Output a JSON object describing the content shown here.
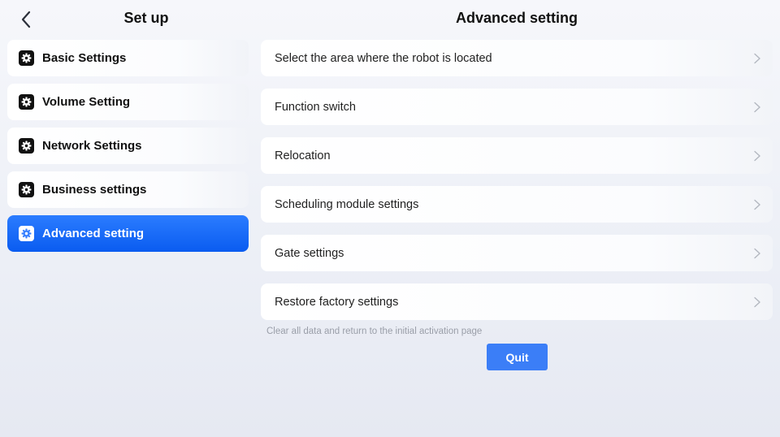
{
  "left_panel": {
    "title": "Set up",
    "back_icon": "chevron-left-icon",
    "items": [
      {
        "label": "Basic Settings",
        "icon": "gear-icon",
        "active": false
      },
      {
        "label": "Volume Setting",
        "icon": "gear-icon",
        "active": false
      },
      {
        "label": "Network Settings",
        "icon": "gear-icon",
        "active": false
      },
      {
        "label": "Business settings",
        "icon": "gear-icon",
        "active": false
      },
      {
        "label": "Advanced setting",
        "icon": "gear-icon",
        "active": true
      }
    ]
  },
  "right_panel": {
    "title": "Advanced setting",
    "rows": [
      {
        "label": "Select the area where the robot is located"
      },
      {
        "label": "Function switch"
      },
      {
        "label": "Relocation"
      },
      {
        "label": "Scheduling module settings"
      },
      {
        "label": "Gate settings"
      },
      {
        "label": "Restore factory settings"
      }
    ],
    "hint": "Clear all data and return to the initial activation page",
    "quit_label": "Quit"
  },
  "colors": {
    "accent": "#0a5cf0",
    "quit_button": "#3b7ef7",
    "hint_text": "#9a9ea8"
  }
}
